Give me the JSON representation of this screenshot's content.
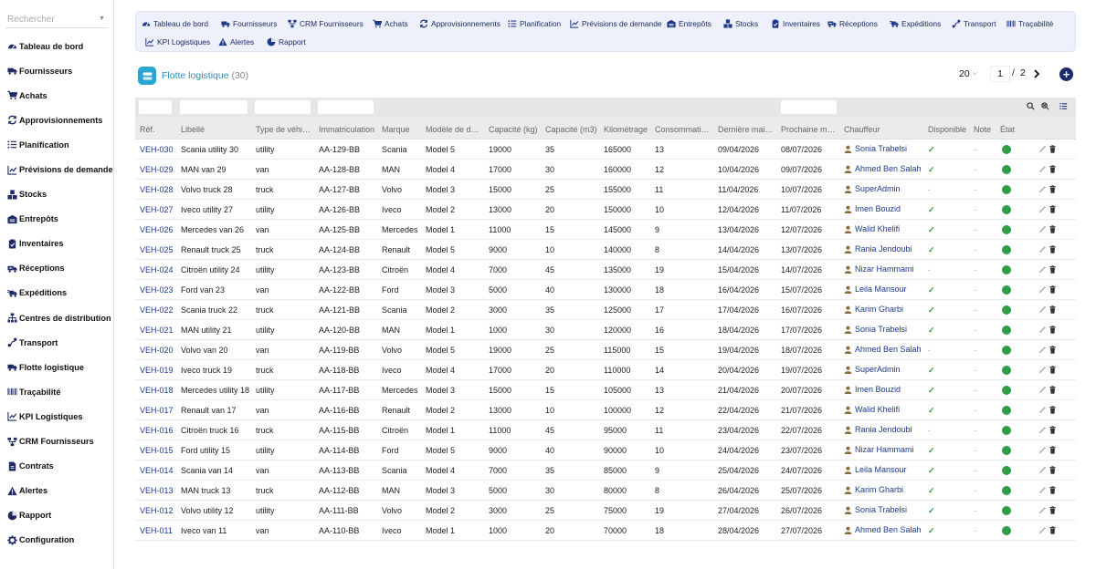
{
  "sidebar": {
    "search_placeholder": "Rechercher",
    "items": [
      {
        "label": "Tableau de bord",
        "icon": "dashboard-icon"
      },
      {
        "label": "Fournisseurs",
        "icon": "truck-icon"
      },
      {
        "label": "Achats",
        "icon": "cart-icon"
      },
      {
        "label": "Approvisionnements",
        "icon": "sync-icon"
      },
      {
        "label": "Planification",
        "icon": "list-icon"
      },
      {
        "label": "Prévisions de demande",
        "icon": "chart-icon"
      },
      {
        "label": "Stocks",
        "icon": "boxes-icon"
      },
      {
        "label": "Entrepôts",
        "icon": "warehouse-icon"
      },
      {
        "label": "Inventaires",
        "icon": "clipboard-icon"
      },
      {
        "label": "Réceptions",
        "icon": "receive-icon"
      },
      {
        "label": "Expéditions",
        "icon": "shipping-icon"
      },
      {
        "label": "Centres de distribution",
        "icon": "network-icon"
      },
      {
        "label": "Transport",
        "icon": "route-icon"
      },
      {
        "label": "Flotte logistique",
        "icon": "fleet-icon"
      },
      {
        "label": "Traçabilité",
        "icon": "barcode-icon"
      },
      {
        "label": "KPI Logistiques",
        "icon": "kpi-icon"
      },
      {
        "label": "CRM Fournisseurs",
        "icon": "crm-icon"
      },
      {
        "label": "Contrats",
        "icon": "contract-icon"
      },
      {
        "label": "Alertes",
        "icon": "warning-icon"
      },
      {
        "label": "Rapport",
        "icon": "report-icon"
      },
      {
        "label": "Configuration",
        "icon": "gear-icon"
      }
    ]
  },
  "topnav": {
    "row1": [
      {
        "label": "Tableau de bord",
        "icon": "dashboard-icon"
      },
      {
        "label": "Fournisseurs",
        "icon": "truck-icon"
      },
      {
        "label": "CRM Fournisseurs",
        "icon": "crm-icon"
      },
      {
        "label": "Achats",
        "icon": "cart-icon"
      },
      {
        "label": "Approvisionnements",
        "icon": "sync-icon"
      },
      {
        "label": "Planification",
        "icon": "list-icon"
      },
      {
        "label": "Prévisions de demande",
        "icon": "chart-icon"
      },
      {
        "label": "Entrepôts",
        "icon": "warehouse-icon"
      },
      {
        "label": "Stocks",
        "icon": "boxes-icon"
      },
      {
        "label": "Inventaires",
        "icon": "clipboard-icon"
      },
      {
        "label": "Réceptions",
        "icon": "receive-icon"
      },
      {
        "label": "Expéditions",
        "icon": "shipping-icon"
      },
      {
        "label": "Transport",
        "icon": "route-icon"
      },
      {
        "label": "Traçabilité",
        "icon": "barcode-icon"
      }
    ],
    "row2": [
      {
        "label": "KPI Logistiques",
        "icon": "kpi-icon"
      },
      {
        "label": "Alertes",
        "icon": "warning-icon"
      },
      {
        "label": "Rapport",
        "icon": "report-icon"
      }
    ]
  },
  "header": {
    "title": "Flotte logistique",
    "count": "(30)",
    "page_size": "20",
    "page_current": "1",
    "page_separator": "/",
    "page_total": "2"
  },
  "colors": {
    "accent": "#1c2a6b",
    "link": "#1d3a8a",
    "title": "#2b8fb8",
    "ok": "#2f9e44"
  },
  "table": {
    "columns": [
      "Réf.",
      "Libellé",
      "Type de véhi…",
      "Immatriculation",
      "Marque",
      "Modèle de d…",
      "Capacité (kg)",
      "Capacité (m3)",
      "Kilométrage",
      "Consommati…",
      "Dernière mai…",
      "Prochaine m…",
      "Chauffeur",
      "Disponible",
      "Note",
      "État"
    ],
    "rows": [
      {
        "ref": "VEH-030",
        "label": "Scania utility 30",
        "type": "utility",
        "plate": "AA-129-BB",
        "brand": "Scania",
        "model": "Model 5",
        "cap_kg": "19000",
        "cap_m3": "35",
        "km": "165000",
        "cons": "13",
        "last": "09/04/2026",
        "next": "08/07/2026",
        "driver": "Sonia Trabelsi",
        "available": "✓",
        "note": "-"
      },
      {
        "ref": "VEH-029",
        "label": "MAN van 29",
        "type": "van",
        "plate": "AA-128-BB",
        "brand": "MAN",
        "model": "Model 4",
        "cap_kg": "17000",
        "cap_m3": "30",
        "km": "160000",
        "cons": "12",
        "last": "10/04/2026",
        "next": "09/07/2026",
        "driver": "Ahmed Ben Salah",
        "available": "✓",
        "note": "-"
      },
      {
        "ref": "VEH-028",
        "label": "Volvo truck 28",
        "type": "truck",
        "plate": "AA-127-BB",
        "brand": "Volvo",
        "model": "Model 3",
        "cap_kg": "15000",
        "cap_m3": "25",
        "km": "155000",
        "cons": "11",
        "last": "11/04/2026",
        "next": "10/07/2026",
        "driver": "SuperAdmin",
        "available": "-",
        "note": "-"
      },
      {
        "ref": "VEH-027",
        "label": "Iveco utility 27",
        "type": "utility",
        "plate": "AA-126-BB",
        "brand": "Iveco",
        "model": "Model 2",
        "cap_kg": "13000",
        "cap_m3": "20",
        "km": "150000",
        "cons": "10",
        "last": "12/04/2026",
        "next": "11/07/2026",
        "driver": "Imen Bouzid",
        "available": "✓",
        "note": "-"
      },
      {
        "ref": "VEH-026",
        "label": "Mercedes van 26",
        "type": "van",
        "plate": "AA-125-BB",
        "brand": "Mercedes",
        "model": "Model 1",
        "cap_kg": "11000",
        "cap_m3": "15",
        "km": "145000",
        "cons": "9",
        "last": "13/04/2026",
        "next": "12/07/2026",
        "driver": "Walid Khelifi",
        "available": "✓",
        "note": "-"
      },
      {
        "ref": "VEH-025",
        "label": "Renault truck 25",
        "type": "truck",
        "plate": "AA-124-BB",
        "brand": "Renault",
        "model": "Model 5",
        "cap_kg": "9000",
        "cap_m3": "10",
        "km": "140000",
        "cons": "8",
        "last": "14/04/2026",
        "next": "13/07/2026",
        "driver": "Rania Jendoubi",
        "available": "✓",
        "note": "-"
      },
      {
        "ref": "VEH-024",
        "label": "Citroën utility 24",
        "type": "utility",
        "plate": "AA-123-BB",
        "brand": "Citroën",
        "model": "Model 4",
        "cap_kg": "7000",
        "cap_m3": "45",
        "km": "135000",
        "cons": "19",
        "last": "15/04/2026",
        "next": "14/07/2026",
        "driver": "Nizar Hammami",
        "available": "-",
        "note": "-"
      },
      {
        "ref": "VEH-023",
        "label": "Ford van 23",
        "type": "van",
        "plate": "AA-122-BB",
        "brand": "Ford",
        "model": "Model 3",
        "cap_kg": "5000",
        "cap_m3": "40",
        "km": "130000",
        "cons": "18",
        "last": "16/04/2026",
        "next": "15/07/2026",
        "driver": "Leila Mansour",
        "available": "✓",
        "note": "-"
      },
      {
        "ref": "VEH-022",
        "label": "Scania truck 22",
        "type": "truck",
        "plate": "AA-121-BB",
        "brand": "Scania",
        "model": "Model 2",
        "cap_kg": "3000",
        "cap_m3": "35",
        "km": "125000",
        "cons": "17",
        "last": "17/04/2026",
        "next": "16/07/2026",
        "driver": "Karim Gharbi",
        "available": "✓",
        "note": "-"
      },
      {
        "ref": "VEH-021",
        "label": "MAN utility 21",
        "type": "utility",
        "plate": "AA-120-BB",
        "brand": "MAN",
        "model": "Model 1",
        "cap_kg": "1000",
        "cap_m3": "30",
        "km": "120000",
        "cons": "16",
        "last": "18/04/2026",
        "next": "17/07/2026",
        "driver": "Sonia Trabelsi",
        "available": "✓",
        "note": "-"
      },
      {
        "ref": "VEH-020",
        "label": "Volvo van 20",
        "type": "van",
        "plate": "AA-119-BB",
        "brand": "Volvo",
        "model": "Model 5",
        "cap_kg": "19000",
        "cap_m3": "25",
        "km": "115000",
        "cons": "15",
        "last": "19/04/2026",
        "next": "18/07/2026",
        "driver": "Ahmed Ben Salah",
        "available": "-",
        "note": "-"
      },
      {
        "ref": "VEH-019",
        "label": "Iveco truck 19",
        "type": "truck",
        "plate": "AA-118-BB",
        "brand": "Iveco",
        "model": "Model 4",
        "cap_kg": "17000",
        "cap_m3": "20",
        "km": "110000",
        "cons": "14",
        "last": "20/04/2026",
        "next": "19/07/2026",
        "driver": "SuperAdmin",
        "available": "✓",
        "note": "-"
      },
      {
        "ref": "VEH-018",
        "label": "Mercedes utility 18",
        "type": "utility",
        "plate": "AA-117-BB",
        "brand": "Mercedes",
        "model": "Model 3",
        "cap_kg": "15000",
        "cap_m3": "15",
        "km": "105000",
        "cons": "13",
        "last": "21/04/2026",
        "next": "20/07/2026",
        "driver": "Imen Bouzid",
        "available": "✓",
        "note": "-"
      },
      {
        "ref": "VEH-017",
        "label": "Renault van 17",
        "type": "van",
        "plate": "AA-116-BB",
        "brand": "Renault",
        "model": "Model 2",
        "cap_kg": "13000",
        "cap_m3": "10",
        "km": "100000",
        "cons": "12",
        "last": "22/04/2026",
        "next": "21/07/2026",
        "driver": "Walid Khelifi",
        "available": "✓",
        "note": "-"
      },
      {
        "ref": "VEH-016",
        "label": "Citroën truck 16",
        "type": "truck",
        "plate": "AA-115-BB",
        "brand": "Citroën",
        "model": "Model 1",
        "cap_kg": "11000",
        "cap_m3": "45",
        "km": "95000",
        "cons": "11",
        "last": "23/04/2026",
        "next": "22/07/2026",
        "driver": "Rania Jendoubi",
        "available": "-",
        "note": "-"
      },
      {
        "ref": "VEH-015",
        "label": "Ford utility 15",
        "type": "utility",
        "plate": "AA-114-BB",
        "brand": "Ford",
        "model": "Model 5",
        "cap_kg": "9000",
        "cap_m3": "40",
        "km": "90000",
        "cons": "10",
        "last": "24/04/2026",
        "next": "23/07/2026",
        "driver": "Nizar Hammami",
        "available": "✓",
        "note": "-"
      },
      {
        "ref": "VEH-014",
        "label": "Scania van 14",
        "type": "van",
        "plate": "AA-113-BB",
        "brand": "Scania",
        "model": "Model 4",
        "cap_kg": "7000",
        "cap_m3": "35",
        "km": "85000",
        "cons": "9",
        "last": "25/04/2026",
        "next": "24/07/2026",
        "driver": "Leila Mansour",
        "available": "✓",
        "note": "-"
      },
      {
        "ref": "VEH-013",
        "label": "MAN truck 13",
        "type": "truck",
        "plate": "AA-112-BB",
        "brand": "MAN",
        "model": "Model 3",
        "cap_kg": "5000",
        "cap_m3": "30",
        "km": "80000",
        "cons": "8",
        "last": "26/04/2026",
        "next": "25/07/2026",
        "driver": "Karim Gharbi",
        "available": "✓",
        "note": "-"
      },
      {
        "ref": "VEH-012",
        "label": "Volvo utility 12",
        "type": "utility",
        "plate": "AA-111-BB",
        "brand": "Volvo",
        "model": "Model 2",
        "cap_kg": "3000",
        "cap_m3": "25",
        "km": "75000",
        "cons": "19",
        "last": "27/04/2026",
        "next": "26/07/2026",
        "driver": "Sonia Trabelsi",
        "available": "✓",
        "note": "-"
      },
      {
        "ref": "VEH-011",
        "label": "Iveco van 11",
        "type": "van",
        "plate": "AA-110-BB",
        "brand": "Iveco",
        "model": "Model 1",
        "cap_kg": "1000",
        "cap_m3": "20",
        "km": "70000",
        "cons": "18",
        "last": "28/04/2026",
        "next": "27/07/2026",
        "driver": "Ahmed Ben Salah",
        "available": "✓",
        "note": "-"
      }
    ]
  }
}
